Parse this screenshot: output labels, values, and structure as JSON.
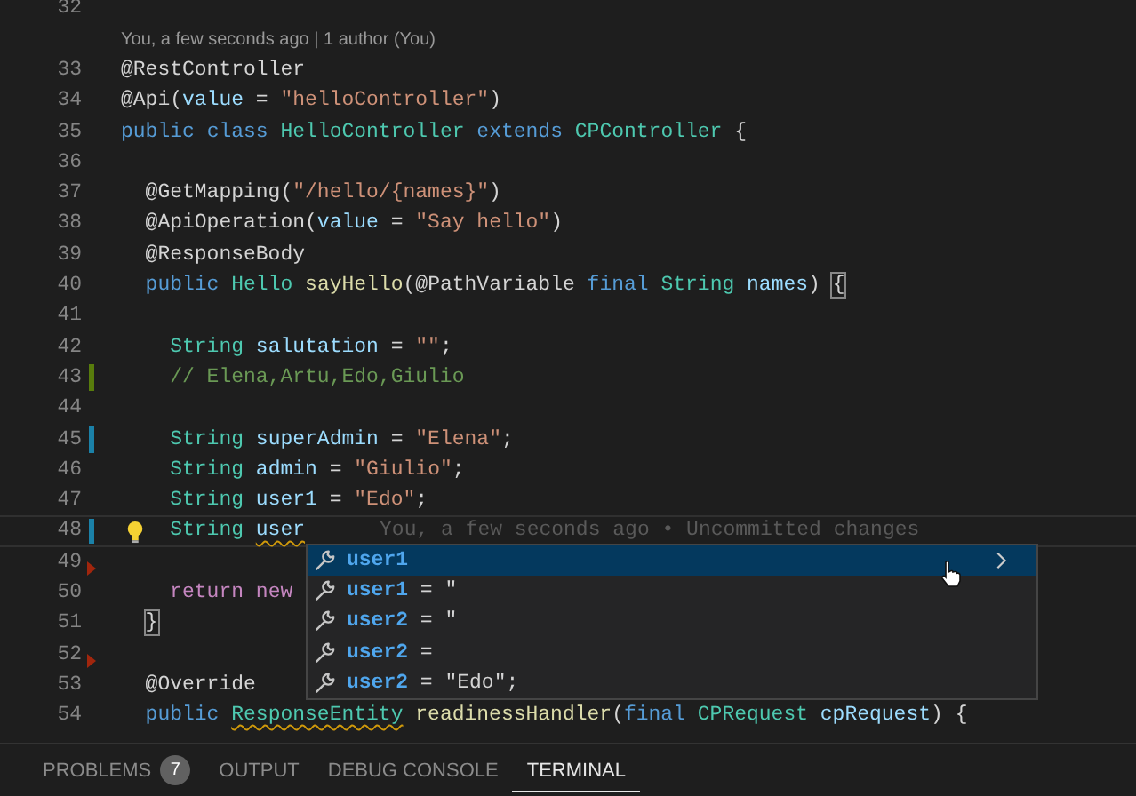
{
  "codelens": "You, a few seconds ago | 1 author (You)",
  "lines": [
    {
      "number": "32"
    },
    {
      "number": "33",
      "tokens": [
        {
          "kind": "plain",
          "text": "@RestController"
        }
      ]
    },
    {
      "number": "34",
      "tokens": [
        {
          "kind": "plain",
          "text": "@Api("
        },
        {
          "kind": "variable",
          "text": "value"
        },
        {
          "kind": "plain",
          "text": " = "
        },
        {
          "kind": "string",
          "text": "\"helloController\""
        },
        {
          "kind": "plain",
          "text": ")"
        }
      ]
    },
    {
      "number": "35",
      "tokens": [
        {
          "kind": "keyword",
          "text": "public"
        },
        {
          "kind": "keyword",
          "text": " class"
        },
        {
          "kind": "type",
          "text": " HelloController"
        },
        {
          "kind": "keyword",
          "text": " extends"
        },
        {
          "kind": "type",
          "text": " CPController"
        },
        {
          "kind": "plain",
          "text": " {"
        }
      ]
    },
    {
      "number": "36"
    },
    {
      "number": "37",
      "tokens": [
        {
          "kind": "plain",
          "text": "  @GetMapping("
        },
        {
          "kind": "string",
          "text": "\"/hello/{names}\""
        },
        {
          "kind": "plain",
          "text": ")"
        }
      ]
    },
    {
      "number": "38",
      "tokens": [
        {
          "kind": "plain",
          "text": "  @ApiOperation("
        },
        {
          "kind": "variable",
          "text": "value"
        },
        {
          "kind": "plain",
          "text": " = "
        },
        {
          "kind": "string",
          "text": "\"Say hello\""
        },
        {
          "kind": "plain",
          "text": ")"
        }
      ]
    },
    {
      "number": "39",
      "tokens": [
        {
          "kind": "plain",
          "text": "  @ResponseBody"
        }
      ]
    },
    {
      "number": "40",
      "tokens": [
        {
          "kind": "keyword",
          "text": "  public"
        },
        {
          "kind": "type",
          "text": " Hello"
        },
        {
          "kind": "function",
          "text": " sayHello"
        },
        {
          "kind": "plain",
          "text": "(@PathVariable "
        },
        {
          "kind": "keyword",
          "text": "final"
        },
        {
          "kind": "type",
          "text": " String"
        },
        {
          "kind": "variable",
          "text": " names"
        },
        {
          "kind": "plain",
          "text": ") "
        },
        {
          "kind": "bracket",
          "text": "{"
        }
      ]
    },
    {
      "number": "41"
    },
    {
      "number": "42",
      "tokens": [
        {
          "kind": "type",
          "text": "    String"
        },
        {
          "kind": "variable",
          "text": " salutation"
        },
        {
          "kind": "plain",
          "text": " = "
        },
        {
          "kind": "string",
          "text": "\"\""
        },
        {
          "kind": "plain",
          "text": ";"
        }
      ]
    },
    {
      "number": "43",
      "added": true,
      "tokens": [
        {
          "kind": "comment",
          "text": "    // Elena,Artu,Edo,Giulio"
        }
      ]
    },
    {
      "number": "44"
    },
    {
      "number": "45",
      "modified": true,
      "tokens": [
        {
          "kind": "type",
          "text": "    String"
        },
        {
          "kind": "variable",
          "text": " superAdmin"
        },
        {
          "kind": "plain",
          "text": " = "
        },
        {
          "kind": "string",
          "text": "\"Elena\""
        },
        {
          "kind": "plain",
          "text": ";"
        }
      ]
    },
    {
      "number": "46",
      "tokens": [
        {
          "kind": "type",
          "text": "    String"
        },
        {
          "kind": "variable",
          "text": " admin"
        },
        {
          "kind": "plain",
          "text": " = "
        },
        {
          "kind": "string",
          "text": "\"Giulio\""
        },
        {
          "kind": "plain",
          "text": ";"
        }
      ]
    },
    {
      "number": "47",
      "tokens": [
        {
          "kind": "type",
          "text": "    String"
        },
        {
          "kind": "variable",
          "text": " user1"
        },
        {
          "kind": "plain",
          "text": " = "
        },
        {
          "kind": "string",
          "text": "\"Edo\""
        },
        {
          "kind": "plain",
          "text": ";"
        }
      ]
    },
    {
      "number": "48",
      "modified": true,
      "current": true,
      "lightbulb": true,
      "blame": "You, a few seconds ago • Uncommitted changes",
      "tokens": [
        {
          "kind": "type",
          "text": "    String "
        },
        {
          "kind": "variable",
          "text": "user",
          "error": true
        }
      ]
    },
    {
      "number": "49",
      "deleted": true
    },
    {
      "number": "50",
      "tokens": [
        {
          "kind": "control",
          "text": "    return"
        },
        {
          "kind": "control",
          "text": " new"
        }
      ]
    },
    {
      "number": "51",
      "tokens": [
        {
          "kind": "bracket",
          "text": "  }"
        }
      ]
    },
    {
      "number": "52",
      "deleted": true
    },
    {
      "number": "53",
      "tokens": [
        {
          "kind": "plain",
          "text": "  @Override"
        }
      ]
    },
    {
      "number": "54",
      "tokens": [
        {
          "kind": "keyword",
          "text": "  public "
        },
        {
          "kind": "type",
          "text": "ResponseEntity",
          "error": true
        },
        {
          "kind": "function",
          "text": " readinessHandler"
        },
        {
          "kind": "plain",
          "text": "("
        },
        {
          "kind": "keyword",
          "text": "final"
        },
        {
          "kind": "type",
          "text": " CPRequest"
        },
        {
          "kind": "variable",
          "text": " cpRequest"
        },
        {
          "kind": "plain",
          "text": ") {"
        }
      ]
    }
  ],
  "suggestions": [
    {
      "label": "user1",
      "selected": true
    },
    {
      "label": "user1",
      "rest": " = \"",
      "selected": false
    },
    {
      "label": "user2",
      "rest": " = \"",
      "selected": false
    },
    {
      "label": "user2",
      "rest": " =",
      "selected": false
    },
    {
      "label": "user2",
      "rest": " = \"Edo\";",
      "selected": false
    }
  ],
  "panel_tabs": [
    {
      "label": "PROBLEMS",
      "badge": "7",
      "selected": false
    },
    {
      "label": "OUTPUT",
      "selected": false
    },
    {
      "label": "DEBUG CONSOLE",
      "selected": false
    },
    {
      "label": "TERMINAL",
      "selected": true
    }
  ]
}
